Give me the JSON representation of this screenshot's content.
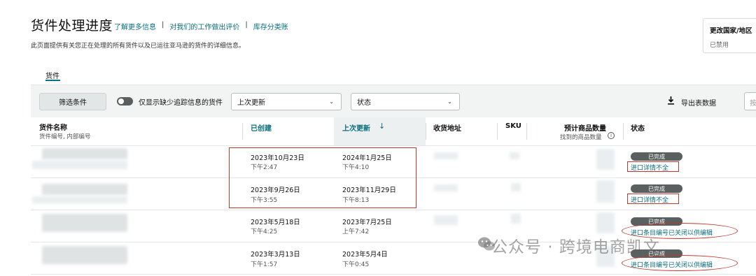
{
  "header": {
    "title": "货件处理进度",
    "links": [
      "了解更多信息",
      "对我们的工作做出评价",
      "库存分类账"
    ],
    "description": "此页面提供有关您正在处理的所有货件以及已运往亚马逊的货件的详细信息。"
  },
  "country_card": {
    "title": "更改国家/地区",
    "value": "已禁用"
  },
  "tabs": [
    {
      "label": "货件"
    }
  ],
  "filters": {
    "filter_button": "筛选条件",
    "toggle_label": "仅显示缺少追踪信息的货件",
    "sort_select": "上次更新",
    "status_select": "状态",
    "export_label": "导出表数据",
    "search_placeholder": "按"
  },
  "table": {
    "columns": {
      "name": "货件名称",
      "name_sub": "货件编号, 内部编号",
      "created": "已创建",
      "updated": "上次更新",
      "address": "收货地址",
      "sku": "SKU",
      "qty": "预计商品数量",
      "qty_sub": "找到的商品数量",
      "status": "状态"
    },
    "rows": [
      {
        "created_date": "2023年10月23日",
        "created_time": "下午2:47",
        "updated_date": "2024年1月25日",
        "updated_time": "下午4:10",
        "status": "已完成",
        "status_note": "进口详情不全"
      },
      {
        "created_date": "2023年9月26日",
        "created_time": "下午3:55",
        "updated_date": "2023年11月29日",
        "updated_time": "下午8:13",
        "status": "已完成",
        "status_note": "进口详情不全"
      },
      {
        "created_date": "2023年5月18日",
        "created_time": "下午4:25",
        "updated_date": "2023年7月25日",
        "updated_time": "上午7:42",
        "status": "已完成",
        "status_note": "进口条目编号已关闭以供编辑"
      },
      {
        "created_date": "2023年3月13日",
        "created_time": "下午1:57",
        "updated_date": "2023年5月4日",
        "updated_time": "下午0:45",
        "status": "已完成",
        "status_note": "进口条目编号已关闭以供编辑"
      }
    ]
  },
  "watermark": "公众号 · 跨境电商凯文",
  "colors": {
    "link": "#0a6f7e",
    "badge": "#5a6060",
    "annotation": "#c0392b"
  }
}
